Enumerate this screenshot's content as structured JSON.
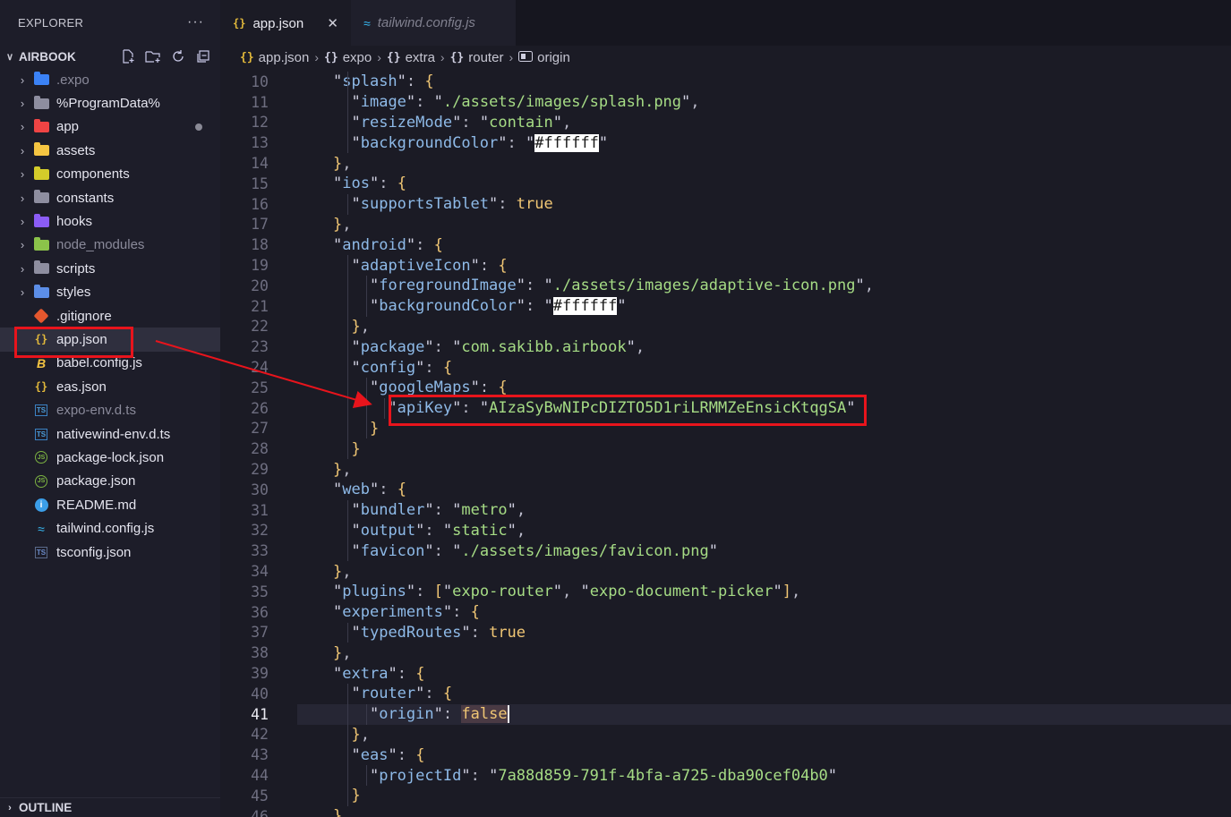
{
  "sidebar": {
    "title": "EXPLORER",
    "more_label": "···",
    "root_label": "AIRBOOK",
    "items": [
      {
        "label": ".expo",
        "kind": "folder",
        "icon": "expo-folder-icon",
        "color": "#3b82f6",
        "dim": true
      },
      {
        "label": "%ProgramData%",
        "kind": "folder",
        "icon": "folder-icon",
        "color": "#8e8ea0",
        "dim": false
      },
      {
        "label": "app",
        "kind": "folder",
        "icon": "app-folder-icon",
        "color": "#ef4444",
        "dim": false
      },
      {
        "label": "assets",
        "kind": "folder",
        "icon": "assets-folder-icon",
        "color": "#f5c542",
        "dim": false
      },
      {
        "label": "components",
        "kind": "folder",
        "icon": "components-folder-icon",
        "color": "#d4cc2a",
        "dim": false
      },
      {
        "label": "constants",
        "kind": "folder",
        "icon": "constants-folder-icon",
        "color": "#8e8ea0",
        "dim": false
      },
      {
        "label": "hooks",
        "kind": "folder",
        "icon": "hooks-folder-icon",
        "color": "#8b5cf6",
        "dim": false
      },
      {
        "label": "node_modules",
        "kind": "folder",
        "icon": "node-modules-folder-icon",
        "color": "#8bc34a",
        "dim": true
      },
      {
        "label": "scripts",
        "kind": "folder",
        "icon": "scripts-folder-icon",
        "color": "#8e8ea0",
        "dim": false
      },
      {
        "label": "styles",
        "kind": "folder",
        "icon": "styles-folder-icon",
        "color": "#5c8ee8",
        "dim": false
      },
      {
        "label": ".gitignore",
        "kind": "file",
        "icon": "git-icon",
        "dim": false
      },
      {
        "label": "app.json",
        "kind": "file",
        "icon": "json-icon",
        "dim": false
      },
      {
        "label": "babel.config.js",
        "kind": "file",
        "icon": "babel-icon",
        "dim": false
      },
      {
        "label": "eas.json",
        "kind": "file",
        "icon": "json-icon",
        "dim": false
      },
      {
        "label": "expo-env.d.ts",
        "kind": "file",
        "icon": "typescript-icon",
        "dim": true
      },
      {
        "label": "nativewind-env.d.ts",
        "kind": "file",
        "icon": "typescript-icon",
        "dim": false
      },
      {
        "label": "package-lock.json",
        "kind": "file",
        "icon": "nodejs-icon",
        "dim": false
      },
      {
        "label": "package.json",
        "kind": "file",
        "icon": "nodejs-icon",
        "dim": false
      },
      {
        "label": "README.md",
        "kind": "file",
        "icon": "info-icon",
        "dim": false
      },
      {
        "label": "tailwind.config.js",
        "kind": "file",
        "icon": "tailwind-icon",
        "dim": false
      },
      {
        "label": "tsconfig.json",
        "kind": "file",
        "icon": "tsconfig-icon",
        "dim": false
      }
    ],
    "outline_label": "OUTLINE"
  },
  "tabs": [
    {
      "label": "app.json",
      "icon": "json-icon",
      "active": true
    },
    {
      "label": "tailwind.config.js",
      "icon": "tailwind-icon",
      "active": false
    }
  ],
  "breadcrumb": {
    "file": "app.json",
    "segments": [
      "expo",
      "extra",
      "router",
      "origin"
    ]
  },
  "code": {
    "current_line": 41,
    "lines": [
      {
        "n": "10",
        "t": "\"splash\": {"
      },
      {
        "n": "11",
        "t": "  \"image\": \"./assets/images/splash.png\","
      },
      {
        "n": "12",
        "t": "  \"resizeMode\": \"contain\","
      },
      {
        "n": "13",
        "t": "  \"backgroundColor\": \"#ffffff\""
      },
      {
        "n": "14",
        "t": "},"
      },
      {
        "n": "15",
        "t": "\"ios\": {"
      },
      {
        "n": "16",
        "t": "  \"supportsTablet\": true"
      },
      {
        "n": "17",
        "t": "},"
      },
      {
        "n": "18",
        "t": "\"android\": {"
      },
      {
        "n": "19",
        "t": "  \"adaptiveIcon\": {"
      },
      {
        "n": "20",
        "t": "    \"foregroundImage\": \"./assets/images/adaptive-icon.png\","
      },
      {
        "n": "21",
        "t": "    \"backgroundColor\": \"#ffffff\""
      },
      {
        "n": "22",
        "t": "  },"
      },
      {
        "n": "23",
        "t": "  \"package\": \"com.sakibb.airbook\","
      },
      {
        "n": "24",
        "t": "  \"config\": {"
      },
      {
        "n": "25",
        "t": "    \"googleMaps\": {"
      },
      {
        "n": "26",
        "t": "      \"apiKey\": \"AIzaSyBwNIPcDIZTO5D1riLRMMZeEnsicKtqgSA\""
      },
      {
        "n": "27",
        "t": "    }"
      },
      {
        "n": "28",
        "t": "  }"
      },
      {
        "n": "29",
        "t": "},"
      },
      {
        "n": "30",
        "t": "\"web\": {"
      },
      {
        "n": "31",
        "t": "  \"bundler\": \"metro\","
      },
      {
        "n": "32",
        "t": "  \"output\": \"static\","
      },
      {
        "n": "33",
        "t": "  \"favicon\": \"./assets/images/favicon.png\""
      },
      {
        "n": "34",
        "t": "},"
      },
      {
        "n": "35",
        "t": "\"plugins\": [\"expo-router\", \"expo-document-picker\"],"
      },
      {
        "n": "36",
        "t": "\"experiments\": {"
      },
      {
        "n": "37",
        "t": "  \"typedRoutes\": true"
      },
      {
        "n": "38",
        "t": "},"
      },
      {
        "n": "39",
        "t": "\"extra\": {"
      },
      {
        "n": "40",
        "t": "  \"router\": {"
      },
      {
        "n": "41",
        "t": "    \"origin\": false"
      },
      {
        "n": "42",
        "t": "  },"
      },
      {
        "n": "43",
        "t": "  \"eas\": {"
      },
      {
        "n": "44",
        "t": "    \"projectId\": \"7a88d859-791f-4bfa-a725-dba90cef04b0\""
      },
      {
        "n": "45",
        "t": "  }"
      },
      {
        "n": "46",
        "t": "}"
      }
    ]
  },
  "colors": {
    "annotation_red": "#e8141c",
    "key_blue": "#8ebae8",
    "string_green": "#a6dc85",
    "bracket_yellow": "#f0c674"
  }
}
